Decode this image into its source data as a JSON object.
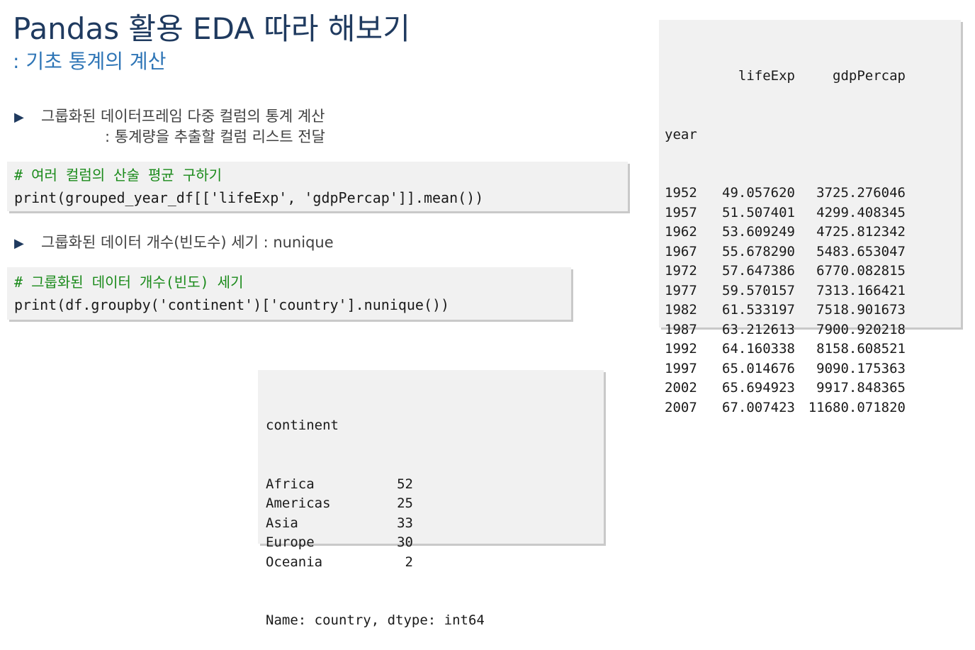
{
  "title": "Pandas 활용 EDA 따라 해보기",
  "subtitle": ": 기초 통계의 계산",
  "bullets": [
    {
      "text": "그룹화된 데이터프레임 다중 컬럼의 통계 계산",
      "sub": ": 통계량을 추출할 컬럼 리스트 전달"
    },
    {
      "text": "그룹화된 데이터 개수(빈도수) 세기 : nunique"
    }
  ],
  "code_blocks": [
    {
      "comment": "# 여러 컬럼의 산술 평균 구하기",
      "code": "print(grouped_year_df[['lifeExp', 'gdpPercap']].mean())"
    },
    {
      "comment": "# 그룹화된 데이터 개수(빈도) 세기",
      "code": "print(df.groupby('continent')['country'].nunique())"
    }
  ],
  "mean_output": {
    "columns": [
      "lifeExp",
      "gdpPercap"
    ],
    "index_name": "year",
    "rows": [
      [
        "1952",
        "49.057620",
        "3725.276046"
      ],
      [
        "1957",
        "51.507401",
        "4299.408345"
      ],
      [
        "1962",
        "53.609249",
        "4725.812342"
      ],
      [
        "1967",
        "55.678290",
        "5483.653047"
      ],
      [
        "1972",
        "57.647386",
        "6770.082815"
      ],
      [
        "1977",
        "59.570157",
        "7313.166421"
      ],
      [
        "1982",
        "61.533197",
        "7518.901673"
      ],
      [
        "1987",
        "63.212613",
        "7900.920218"
      ],
      [
        "1992",
        "64.160338",
        "8158.608521"
      ],
      [
        "1997",
        "65.014676",
        "9090.175363"
      ],
      [
        "2002",
        "65.694923",
        "9917.848365"
      ],
      [
        "2007",
        "67.007423",
        "11680.071820"
      ]
    ]
  },
  "nunique_output": {
    "header": "continent",
    "rows": [
      [
        "Africa",
        "52"
      ],
      [
        "Americas",
        "25"
      ],
      [
        "Asia",
        "33"
      ],
      [
        "Europe",
        "30"
      ],
      [
        "Oceania",
        "2"
      ]
    ],
    "footer": "Name: country, dtype: int64"
  }
}
